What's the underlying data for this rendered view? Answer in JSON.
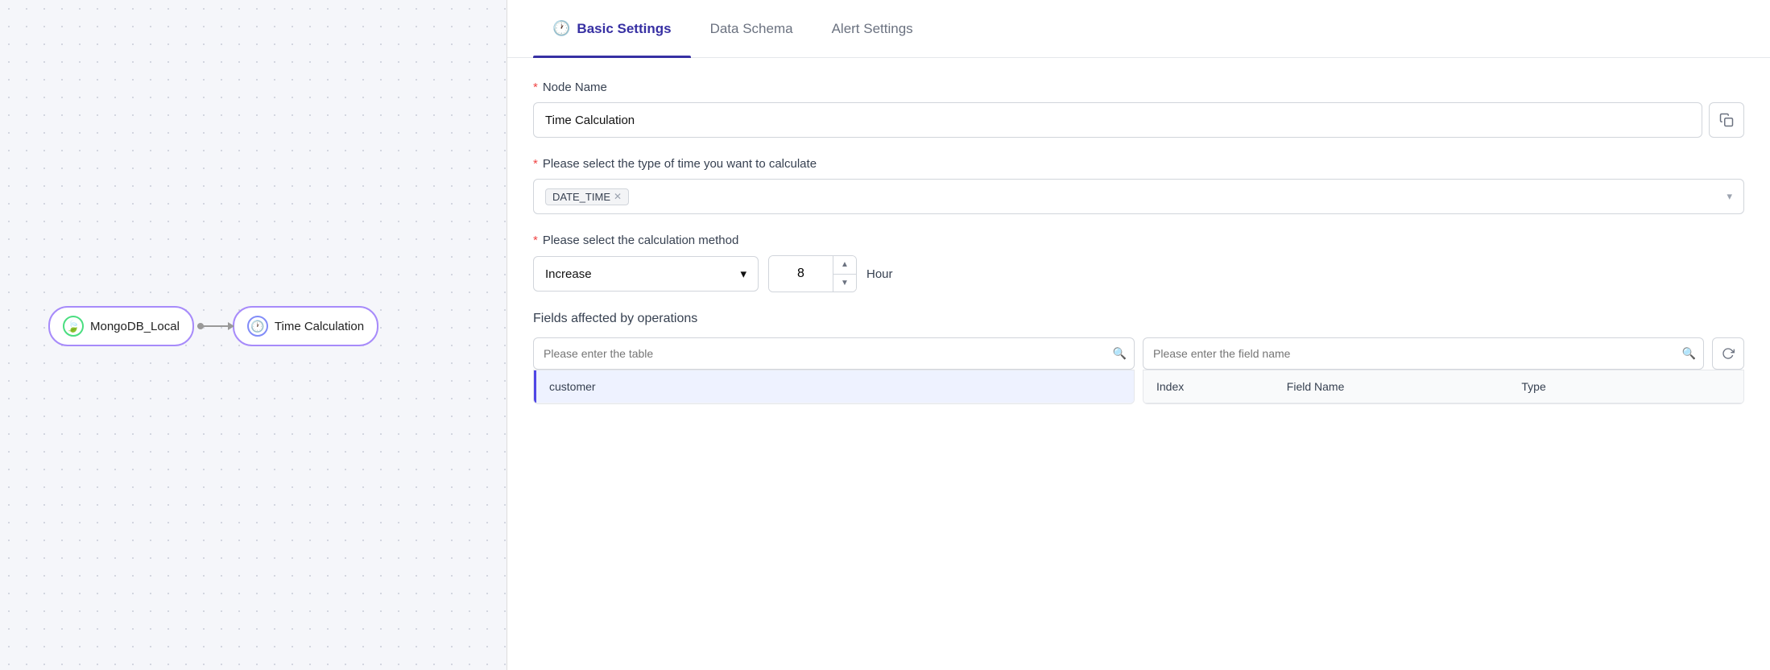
{
  "canvas": {
    "nodes": [
      {
        "id": "mongodb",
        "label": "MongoDB_Local",
        "icon": "🍃",
        "icon_type": "mongo"
      },
      {
        "id": "time_calc",
        "label": "Time Calculation",
        "icon": "🕐",
        "icon_type": "time"
      }
    ]
  },
  "tabs": [
    {
      "id": "basic",
      "label": "Basic Settings",
      "icon": "🕐",
      "active": true
    },
    {
      "id": "schema",
      "label": "Data Schema",
      "active": false
    },
    {
      "id": "alert",
      "label": "Alert Settings",
      "active": false
    }
  ],
  "form": {
    "node_name_label": "Node Name",
    "node_name_value": "Time Calculation",
    "time_type_label": "Please select the type of time you want to calculate",
    "time_type_tag": "DATE_TIME",
    "calc_method_label": "Please select the calculation method",
    "calc_method_value": "Increase",
    "calc_number": "8",
    "calc_unit": "Hour",
    "fields_section_title": "Fields affected by operations",
    "table_search_placeholder": "Please enter the table ",
    "field_search_placeholder": "Please enter the field name",
    "table_col_name": "customer",
    "table_headers": {
      "name": "customer",
      "index": "Index",
      "field_name": "Field Name",
      "type": "Type"
    }
  },
  "colors": {
    "active_tab": "#3730a3",
    "border_accent": "#4f46e5",
    "tag_bg": "#f3f4f6",
    "row_bg": "#eef2ff",
    "required_star": "#ef4444"
  }
}
